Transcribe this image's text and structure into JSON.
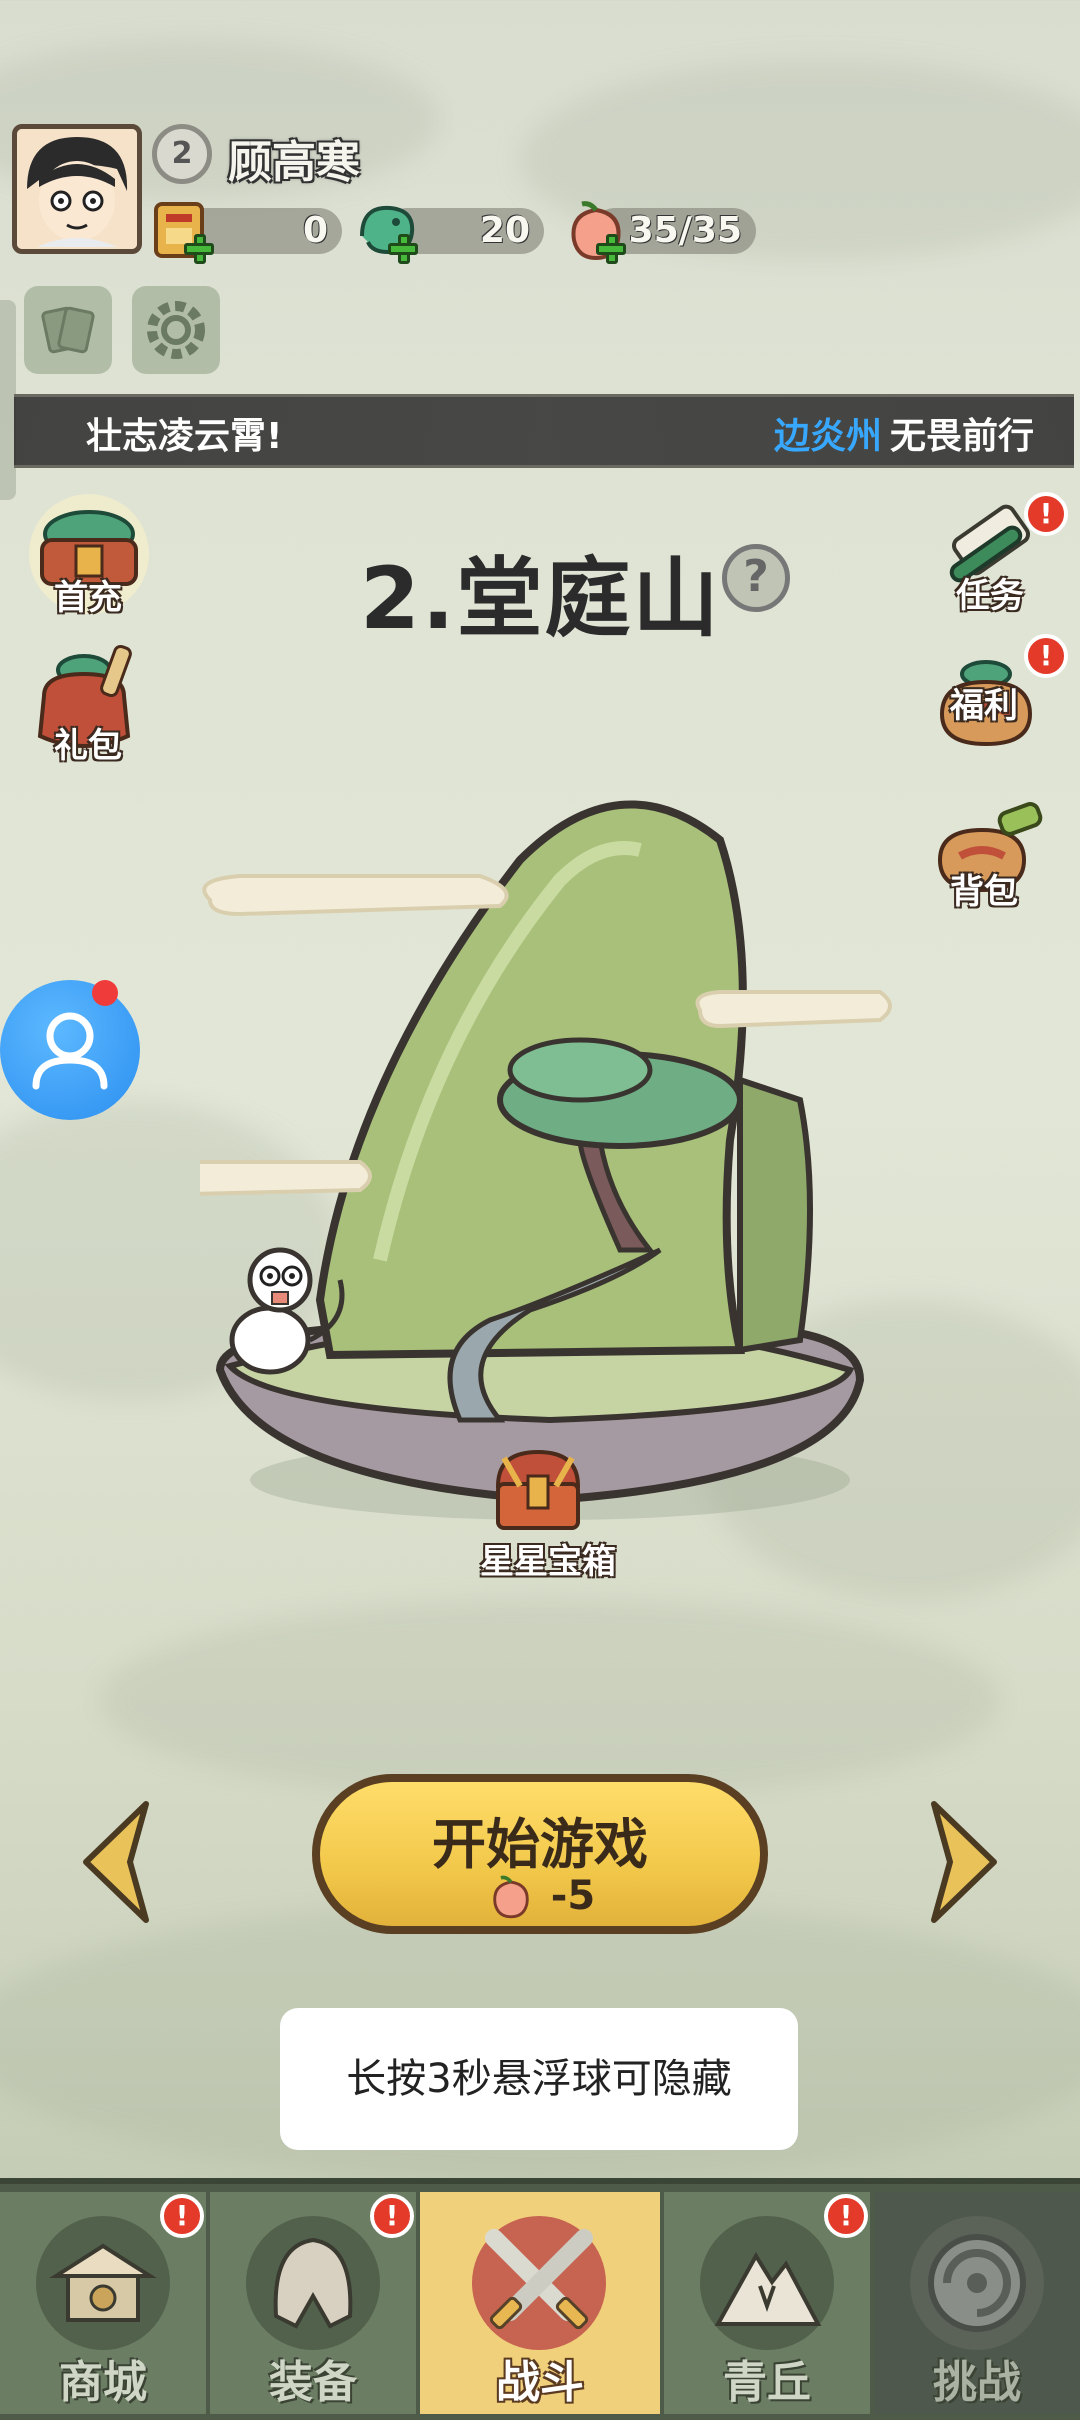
{
  "player": {
    "level": "2",
    "name": "顾高寒"
  },
  "resources": [
    {
      "icon": "gold-ticket-icon",
      "value": "0"
    },
    {
      "icon": "jade-dragon-icon",
      "value": "20"
    },
    {
      "icon": "peach-icon",
      "value": "35/35"
    }
  ],
  "banner": {
    "left_text": "壮志凌云霄!",
    "highlight": "边炎州",
    "right_text": "无畏前行"
  },
  "side_left": [
    {
      "label": "首充"
    },
    {
      "label": "礼包"
    }
  ],
  "side_right": [
    {
      "label": "任务",
      "alert": "!"
    },
    {
      "label": "福利",
      "alert": "!"
    },
    {
      "label": "背包"
    }
  ],
  "stage": {
    "title": "2.堂庭山",
    "help": "?"
  },
  "chest": {
    "label": "星星宝箱"
  },
  "start": {
    "title": "开始游戏",
    "cost": "-5"
  },
  "toast": "长按3秒悬浮球可隐藏",
  "nav": [
    {
      "label": "商城",
      "alert": "!"
    },
    {
      "label": "装备",
      "alert": "!"
    },
    {
      "label": "战斗"
    },
    {
      "label": "青丘",
      "alert": "!"
    },
    {
      "label": "挑战"
    }
  ],
  "colors": {
    "accent": "#f2c84a",
    "alert": "#e33a2a",
    "highlight": "#38a8ff",
    "float_ball": "#2c8ff0"
  }
}
